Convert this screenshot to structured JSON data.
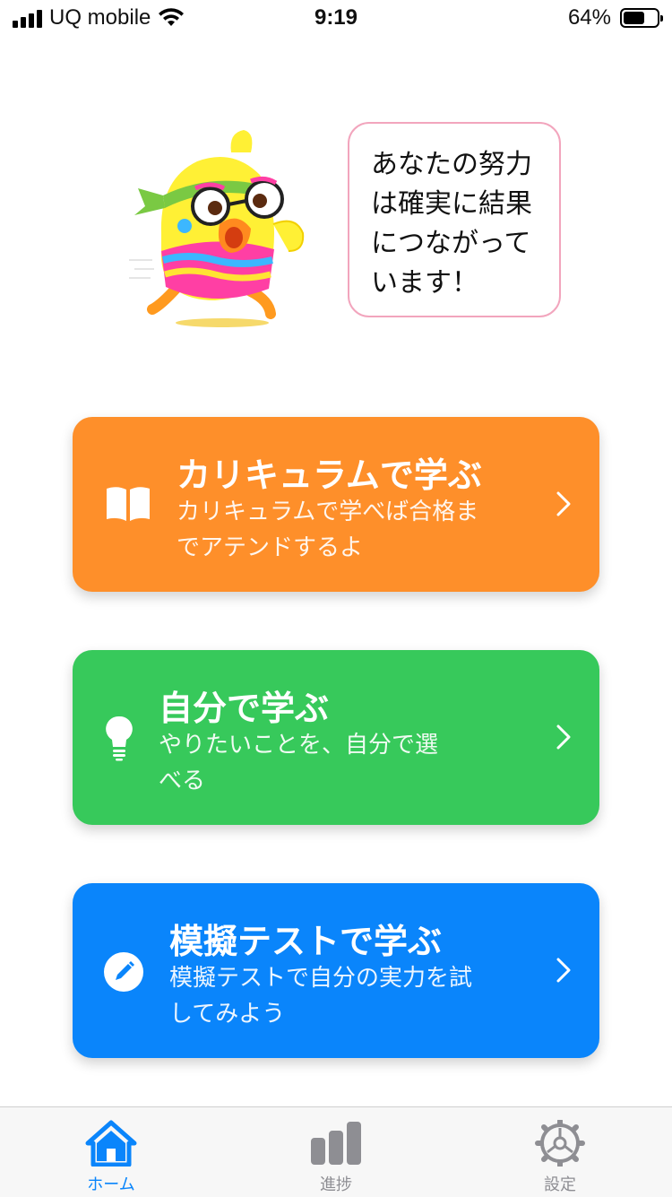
{
  "status_bar": {
    "carrier": "UQ mobile",
    "time": "9:19",
    "battery_text": "64%",
    "battery_level": 0.64
  },
  "mascot": {
    "icon": "running-bird-mascot",
    "speech": "あなたの努力は確実に結果につながっています！"
  },
  "cards": [
    {
      "id": "curriculum",
      "icon": "book-icon",
      "title": "カリキュラムで学ぶ",
      "description": "カリキュラムで学べば合格までアテンドするよ",
      "color": "#fe8f2a"
    },
    {
      "id": "self-study",
      "icon": "lightbulb-icon",
      "title": "自分で学ぶ",
      "description": "やりたいことを、自分で選べる",
      "color": "#37c95b"
    },
    {
      "id": "mock-test",
      "icon": "pencil-icon",
      "title": "模擬テストで学ぶ",
      "description": "模擬テストで自分の実力を試してみよう",
      "color": "#0a85fb"
    }
  ],
  "tab_bar": {
    "items": [
      {
        "label": "ホーム",
        "icon": "home-icon",
        "active": true
      },
      {
        "label": "進捗",
        "icon": "bar-chart-icon",
        "active": false
      },
      {
        "label": "設定",
        "icon": "gear-icon",
        "active": false
      }
    ],
    "active_color": "#0a85fb",
    "inactive_color": "#8e8e93"
  }
}
